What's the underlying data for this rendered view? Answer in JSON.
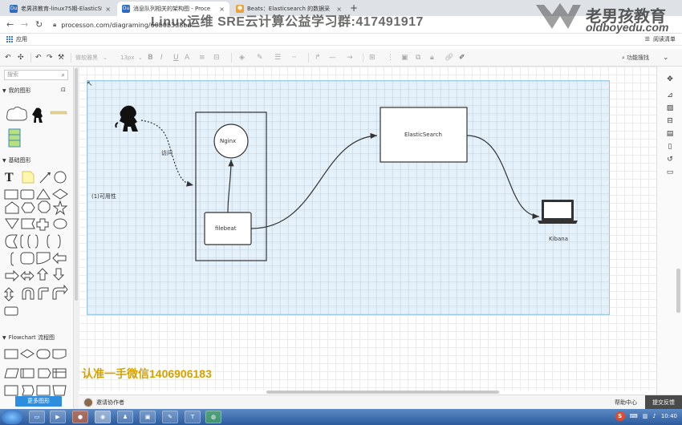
{
  "browser": {
    "tabs": [
      {
        "title": "老男孩教育-linux75期-ElasticSt",
        "favicon": "Ou",
        "favcolor": "#2f6bbf"
      },
      {
        "title": "消息队列相关的架构图 - Proce",
        "favicon": "Ou",
        "favcolor": "#2f6bbf"
      },
      {
        "title": "Beats：Elasticsearch 的数据采",
        "favicon": "☻",
        "favcolor": "#e8a33d"
      }
    ],
    "new_tab": "+",
    "url": "processon.com/diagraming/60b0b3d8bd",
    "bookmark_apps": "应用",
    "reading_list": "阅读清单"
  },
  "watermarks": {
    "group": "Linux运维 SRE云计算公益学习群:417491917",
    "logo_name": "老男孩教育",
    "logo_site": "oldboyedu.com",
    "wechat": "认准一手微信1406906183"
  },
  "toolbar": {
    "font_family": "微软雅黑",
    "font_size": "13px",
    "bold": "B",
    "italic": "I",
    "underline": "U",
    "font_color": "A",
    "find_replace": "功能搜找"
  },
  "left_panel": {
    "search_placeholder": "搜索",
    "sections": {
      "my_shapes": "我的图形",
      "basic": "基础图形",
      "flowchart": "Flowchart 流程图"
    },
    "more_shapes": "更多图形"
  },
  "diagram": {
    "nodes": {
      "access_label": "访问",
      "availability": "(1)可用性",
      "nginx": "Nginx",
      "filebeat": "filebeat",
      "elasticsearch": "ElasticSearch",
      "kibana": "Kibana"
    }
  },
  "bottom": {
    "invite": "邀请协作者",
    "help": "帮助中心",
    "feedback": "提交反馈"
  },
  "taskbar": {
    "clock": "10:40"
  }
}
